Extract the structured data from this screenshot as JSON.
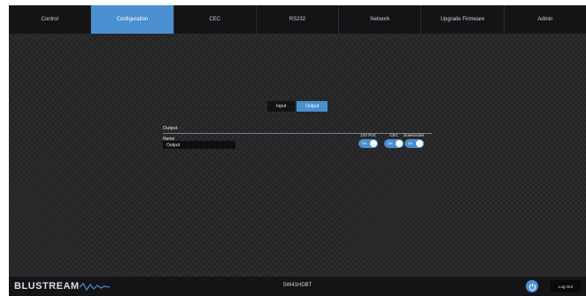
{
  "nav": {
    "tabs": [
      "Control",
      "Configuration",
      "CEC",
      "RS232",
      "Network",
      "Upgrade Firmware",
      "Admin"
    ],
    "active": "Configuration"
  },
  "subtabs": {
    "input": "Input",
    "output": "Output",
    "active": "Output"
  },
  "output_section": {
    "title": "Output",
    "name_label": "Name",
    "name_value": "Output",
    "toggles": [
      {
        "label": "12V PoC",
        "state": "On"
      },
      {
        "label": "CEC",
        "state": "On"
      },
      {
        "label": "Downscaler",
        "state": "On"
      }
    ]
  },
  "footer": {
    "brand": "BLUSTREAM",
    "device": "SW41HDBT",
    "logout_label": "Log Out"
  },
  "colors": {
    "accent": "#4a8fd0",
    "background": "#242426",
    "bar": "#141416"
  }
}
